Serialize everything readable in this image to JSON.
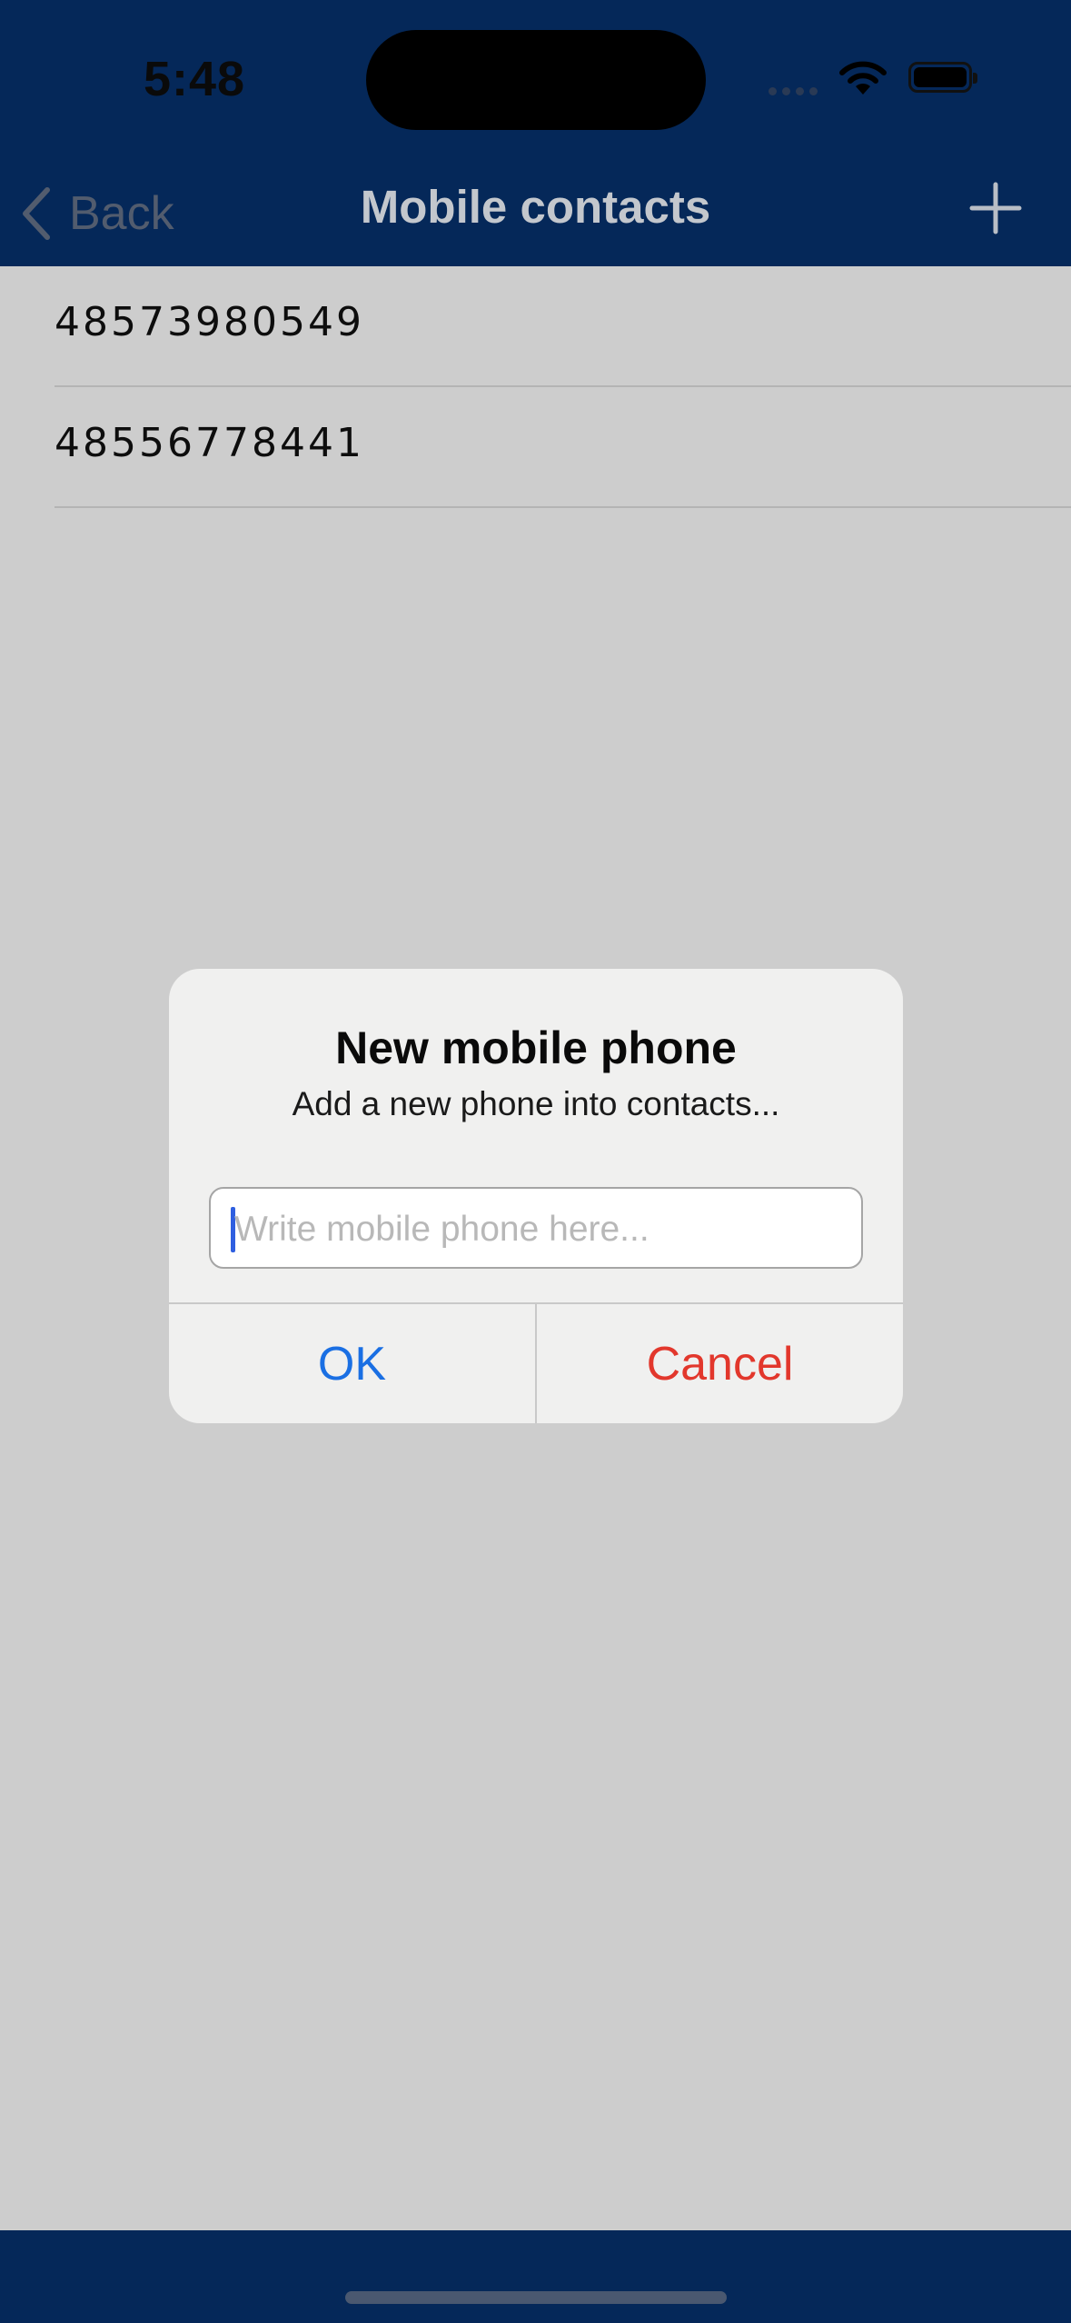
{
  "status_bar": {
    "time": "5:48"
  },
  "nav": {
    "back_label": "Back",
    "title": "Mobile contacts"
  },
  "contacts": [
    "48573980549",
    "48556778441"
  ],
  "dialog": {
    "title": "New mobile phone",
    "message": "Add a new phone into contacts...",
    "input_placeholder": "Write mobile phone here...",
    "input_value": "",
    "ok_label": "OK",
    "cancel_label": "Cancel"
  },
  "colors": {
    "nav_background": "#052859",
    "accent_blue": "#1a6fe3",
    "destructive_red": "#e2372c"
  }
}
